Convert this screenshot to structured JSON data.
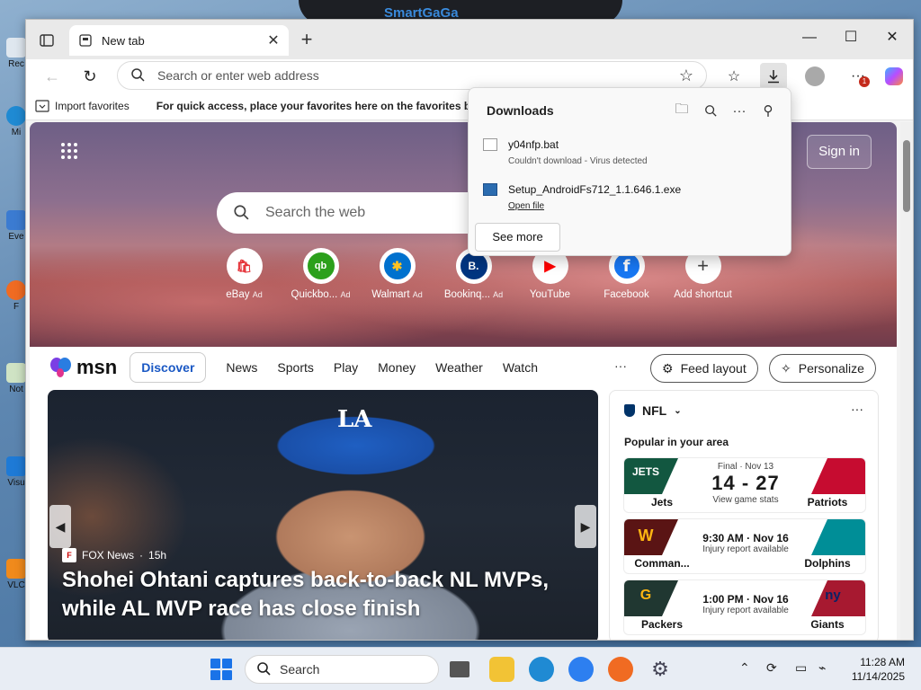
{
  "desktop": {
    "icons": [
      "Rec",
      "Mi",
      "Eve",
      "F",
      "Not",
      "Visu",
      "VLC"
    ],
    "overlay_title": "SmartGaGa"
  },
  "browser": {
    "tab": {
      "title": "New tab"
    },
    "address_placeholder": "Search or enter web address",
    "favorites_bar": {
      "import_label": "Import favorites",
      "hint": "For quick access, place your favorites here on the favorites bar."
    },
    "notification_count": "1"
  },
  "downloads": {
    "title": "Downloads",
    "items": [
      {
        "name": "y04nfp.bat",
        "status": "Couldn't download - Virus detected"
      },
      {
        "name": "Setup_AndroidFs712_1.1.646.1.exe",
        "action": "Open file"
      }
    ],
    "see_more": "See more"
  },
  "newtab": {
    "sign_in": "Sign in",
    "search_placeholder": "Search the web",
    "quick_links": [
      {
        "label": "eBay",
        "ad": "Ad",
        "glyph": "🛍",
        "color": "#e53238"
      },
      {
        "label": "Quickbo...",
        "ad": "Ad",
        "glyph": "qb",
        "color": "#2ca01c"
      },
      {
        "label": "Walmart",
        "ad": "Ad",
        "glyph": "✱",
        "color": "#0071ce"
      },
      {
        "label": "Bookinq...",
        "ad": "Ad",
        "glyph": "B.",
        "color": "#003580"
      },
      {
        "label": "YouTube",
        "ad": "",
        "glyph": "▶",
        "color": "#ff0000"
      },
      {
        "label": "Facebook",
        "ad": "",
        "glyph": "f",
        "color": "#1877f2"
      },
      {
        "label": "Add shortcut",
        "ad": "",
        "glyph": "+",
        "color": "#444444"
      }
    ],
    "feed": {
      "brand": "msn",
      "tabs": [
        "Discover",
        "News",
        "Sports",
        "Play",
        "Money",
        "Weather",
        "Watch"
      ],
      "more": "···",
      "feed_layout": "Feed layout",
      "personalize": "Personalize"
    },
    "hero_story": {
      "source": "FOX News",
      "age": "15h",
      "headline": "Shohei Ohtani captures back-to-back NL MVPs, while AL MVP race has close finish",
      "cap_logo": "LA"
    },
    "nfl": {
      "league": "NFL",
      "subtitle": "Popular in your area",
      "games": [
        {
          "home": "Jets",
          "away": "Patriots",
          "top": "Final · Nov 13",
          "score": "14 - 27",
          "bottom": "View game stats",
          "home_color": "#125740",
          "away_color": "#c60c30"
        },
        {
          "home": "Comman...",
          "away": "Dolphins",
          "time": "9:30 AM · Nov 16",
          "bottom": "Injury report available",
          "home_color": "#5a1414",
          "away_color": "#008e97"
        },
        {
          "home": "Packers",
          "away": "Giants",
          "time": "1:00 PM · Nov 16",
          "bottom": "Injury report available",
          "home_color": "#203731",
          "away_color": "#a71930"
        }
      ]
    }
  },
  "taskbar": {
    "search": "Search",
    "time": "11:28 AM",
    "date": "11/14/2025"
  }
}
